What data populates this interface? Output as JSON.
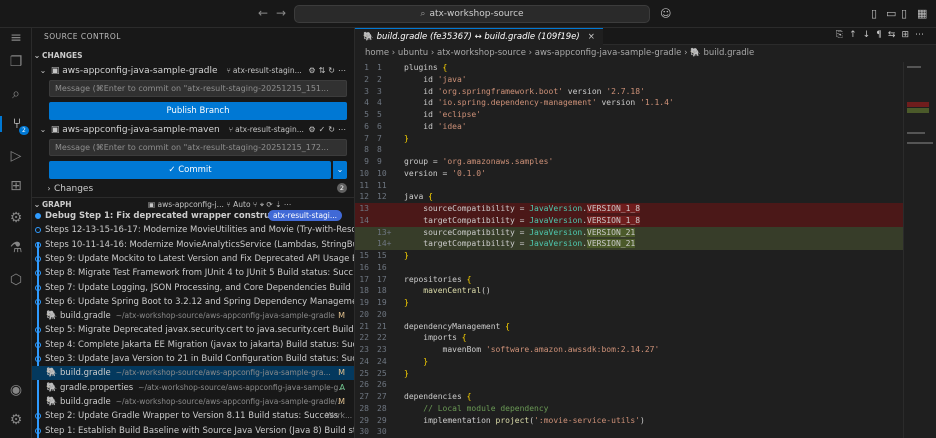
{
  "titlebar": {
    "search_text": "atx-workshop-source",
    "back": "←",
    "forward": "→"
  },
  "sidebar": {
    "title": "SOURCE CONTROL",
    "changes_header": "CHANGES",
    "repos": [
      {
        "name": "aws-appconfig-java-sample-gradle",
        "branch": "atx-result-stagin...",
        "message_placeholder": "Message (⌘Enter to commit on \"atx-result-staging-20251215_151...",
        "action_label": "Publish Branch"
      },
      {
        "name": "aws-appconfig-java-sample-maven",
        "branch": "atx-result-stagin...",
        "message_placeholder": "Message (⌘Enter to commit on \"atx-result-staging-20251215_172...",
        "action_label": "✓ Commit"
      }
    ],
    "changes_subheader": "Changes",
    "changes_count": "2",
    "graph": {
      "header": "GRAPH",
      "repo_filter": "aws-appconfig-j...",
      "auto_label": "Auto",
      "items": [
        {
          "kind": "commit",
          "text": "Debug Step 1: Fix deprecated wrapper constructors...",
          "ref": "atx-result-stagi..."
        },
        {
          "kind": "commit",
          "text": "Steps 12-13-15-16-17: Modernize MovieUtilities and Movie (Try-with-Reso..."
        },
        {
          "kind": "commit",
          "text": "Steps 10-11-14-16: Modernize MovieAnalyticsService (Lambdas, StringBui..."
        },
        {
          "kind": "commit",
          "text": "Step 9: Update Mockito to Latest Version and Fix Deprecated API Usage B..."
        },
        {
          "kind": "commit",
          "text": "Step 8: Migrate Test Framework from JUnit 4 to JUnit 5 Build status: Succ..."
        },
        {
          "kind": "commit",
          "text": "Step 7: Update Logging, JSON Processing, and Core Dependencies Build ..."
        },
        {
          "kind": "commit",
          "text": "Step 6: Update Spring Boot to 3.2.12 and Spring Dependency Manageme..."
        },
        {
          "kind": "file",
          "name": "build.gradle",
          "path": "~/atx-workshop-source/aws-appconfig-java-sample-gradle",
          "status": "M"
        },
        {
          "kind": "commit",
          "text": "Step 5: Migrate Deprecated javax.security.cert to java.security.cert Build s..."
        },
        {
          "kind": "commit",
          "text": "Step 4: Complete Jakarta EE Migration (javax to jakarta) Build status: Suc..."
        },
        {
          "kind": "commit",
          "text": "Step 3: Update Java Version to 21 in Build Configuration Build status: Suc..."
        },
        {
          "kind": "file",
          "name": "build.gradle",
          "path": "~/atx-workshop-source/aws-appconfig-java-sample-gra...",
          "status": "M",
          "selected": true
        },
        {
          "kind": "file",
          "name": "gradle.properties",
          "path": "~/atx-workshop-source/aws-appconfig-java-sample-g...",
          "status": "A"
        },
        {
          "kind": "file",
          "name": "build.gradle",
          "path": "~/atx-workshop-source/aws-appconfig-java-sample-gradle/...",
          "status": "M"
        },
        {
          "kind": "commit",
          "text": "Step 2: Update Gradle Wrapper to Version 8.11 Build status: Success",
          "author": "Work..."
        },
        {
          "kind": "commit",
          "text": "Step 1: Establish Build Baseline with Source Java Version (Java 8) Build st..."
        }
      ]
    }
  },
  "editor": {
    "tab_label": "build.gradle (fe35367) ↔ build.gradle (109f19e)",
    "breadcrumbs": [
      "home",
      "ubuntu",
      "atx-workshop-source",
      "aws-appconfig-java-sample-gradle",
      "build.gradle"
    ],
    "lines": [
      {
        "n": "1",
        "n2": "1",
        "text": "plugins {"
      },
      {
        "n": "2",
        "n2": "2",
        "text": "    id 'java'"
      },
      {
        "n": "3",
        "n2": "3",
        "text": "    id 'org.springframework.boot' version '2.7.18'"
      },
      {
        "n": "4",
        "n2": "4",
        "text": "    id 'io.spring.dependency-management' version '1.1.4'"
      },
      {
        "n": "5",
        "n2": "5",
        "text": "    id 'eclipse'"
      },
      {
        "n": "6",
        "n2": "6",
        "text": "    id 'idea'"
      },
      {
        "n": "7",
        "n2": "7",
        "text": "}"
      },
      {
        "n": "8",
        "n2": "8",
        "text": ""
      },
      {
        "n": "9",
        "n2": "9",
        "text": "group = 'org.amazonaws.samples'"
      },
      {
        "n": "10",
        "n2": "10",
        "text": "version = '0.1.0'"
      },
      {
        "n": "11",
        "n2": "11",
        "text": ""
      },
      {
        "n": "12",
        "n2": "12",
        "text": "java {"
      },
      {
        "n": "13",
        "n2": "",
        "text": "    sourceCompatibility = JavaVersion.VERSION_1_8",
        "kind": "del"
      },
      {
        "n": "14",
        "n2": "",
        "text": "    targetCompatibility = JavaVersion.VERSION_1_8",
        "kind": "del"
      },
      {
        "n": "",
        "n2": "13+",
        "text": "    sourceCompatibility = JavaVersion.VERSION_21",
        "kind": "add"
      },
      {
        "n": "",
        "n2": "14+",
        "text": "    targetCompatibility = JavaVersion.VERSION_21",
        "kind": "add"
      },
      {
        "n": "15",
        "n2": "15",
        "text": "}"
      },
      {
        "n": "16",
        "n2": "16",
        "text": ""
      },
      {
        "n": "17",
        "n2": "17",
        "text": "repositories {"
      },
      {
        "n": "18",
        "n2": "18",
        "text": "    mavenCentral()"
      },
      {
        "n": "19",
        "n2": "19",
        "text": "}"
      },
      {
        "n": "20",
        "n2": "20",
        "text": ""
      },
      {
        "n": "21",
        "n2": "21",
        "text": "dependencyManagement {"
      },
      {
        "n": "22",
        "n2": "22",
        "text": "    imports {"
      },
      {
        "n": "23",
        "n2": "23",
        "text": "        mavenBom 'software.amazon.awssdk:bom:2.14.27'"
      },
      {
        "n": "24",
        "n2": "24",
        "text": "    }"
      },
      {
        "n": "25",
        "n2": "25",
        "text": "}"
      },
      {
        "n": "26",
        "n2": "26",
        "text": ""
      },
      {
        "n": "27",
        "n2": "27",
        "text": "dependencies {"
      },
      {
        "n": "28",
        "n2": "28",
        "text": "    // Local module dependency"
      },
      {
        "n": "29",
        "n2": "29",
        "text": "    implementation project(':movie-service-utils')"
      },
      {
        "n": "30",
        "n2": "30",
        "text": ""
      }
    ]
  },
  "colors": {
    "accent": "#0078d4",
    "deleted_bg": "#4b1818",
    "added_bg": "#373d29"
  }
}
